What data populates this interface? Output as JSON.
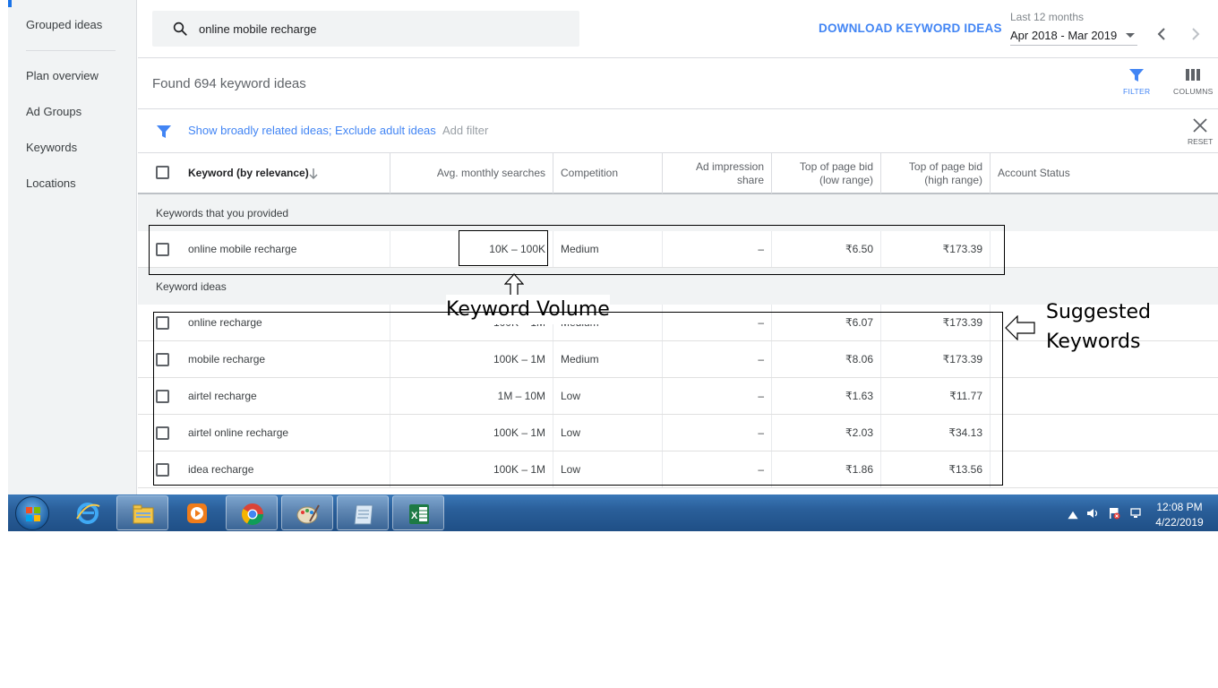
{
  "sidebar": {
    "items": [
      {
        "label": "Grouped ideas"
      },
      {
        "label": "Plan overview"
      },
      {
        "label": "Ad Groups"
      },
      {
        "label": "Keywords"
      },
      {
        "label": "Locations"
      }
    ]
  },
  "topbar": {
    "search_value": "online mobile recharge",
    "download_label": "DOWNLOAD KEYWORD IDEAS",
    "date_range_label": "Last 12 months",
    "date_range_value": "Apr 2018 - Mar 2019"
  },
  "toolbar": {
    "found_text": "Found 694 keyword ideas",
    "filter_label": "FILTER",
    "columns_label": "COLUMNS"
  },
  "filters": {
    "active_text": "Show broadly related ideas; Exclude adult ideas",
    "add_filter_label": "Add filter",
    "reset_label": "RESET"
  },
  "table": {
    "headers": {
      "keyword": "Keyword (by relevance)",
      "searches": "Avg. monthly searches",
      "competition": "Competition",
      "impression_1": "Ad impression",
      "impression_2": "share",
      "bid_low_1": "Top of page bid",
      "bid_low_2": "(low range)",
      "bid_high_1": "Top of page bid",
      "bid_high_2": "(high range)",
      "status": "Account Status"
    },
    "provided_section": "Keywords that you provided",
    "ideas_section": "Keyword ideas",
    "provided": [
      {
        "keyword": "online mobile recharge",
        "searches": "10K – 100K",
        "competition": "Medium",
        "impression": "–",
        "bid_low": "₹6.50",
        "bid_high": "₹173.39"
      }
    ],
    "ideas": [
      {
        "keyword": "online recharge",
        "searches": "100K – 1M",
        "competition": "Medium",
        "impression": "–",
        "bid_low": "₹6.07",
        "bid_high": "₹173.39"
      },
      {
        "keyword": "mobile recharge",
        "searches": "100K – 1M",
        "competition": "Medium",
        "impression": "–",
        "bid_low": "₹8.06",
        "bid_high": "₹173.39"
      },
      {
        "keyword": "airtel recharge",
        "searches": "1M – 10M",
        "competition": "Low",
        "impression": "–",
        "bid_low": "₹1.63",
        "bid_high": "₹11.77"
      },
      {
        "keyword": "airtel online recharge",
        "searches": "100K – 1M",
        "competition": "Low",
        "impression": "–",
        "bid_low": "₹2.03",
        "bid_high": "₹34.13"
      },
      {
        "keyword": "idea recharge",
        "searches": "100K – 1M",
        "competition": "Low",
        "impression": "–",
        "bid_low": "₹1.86",
        "bid_high": "₹13.56"
      }
    ]
  },
  "annotations": {
    "volume_label": "Keyword Volume",
    "suggested_line1": "Suggested",
    "suggested_line2": "Keywords"
  },
  "taskbar": {
    "time": "12:08 PM",
    "date": "4/22/2019",
    "apps": [
      "ie-icon",
      "explorer-icon",
      "media-player-icon",
      "chrome-icon",
      "paint-icon",
      "notepad-icon",
      "excel-icon"
    ]
  },
  "colors": {
    "accent": "#4285f4",
    "sidebar_bg": "#f1f3f4",
    "taskbar": "#2a5f9a"
  }
}
